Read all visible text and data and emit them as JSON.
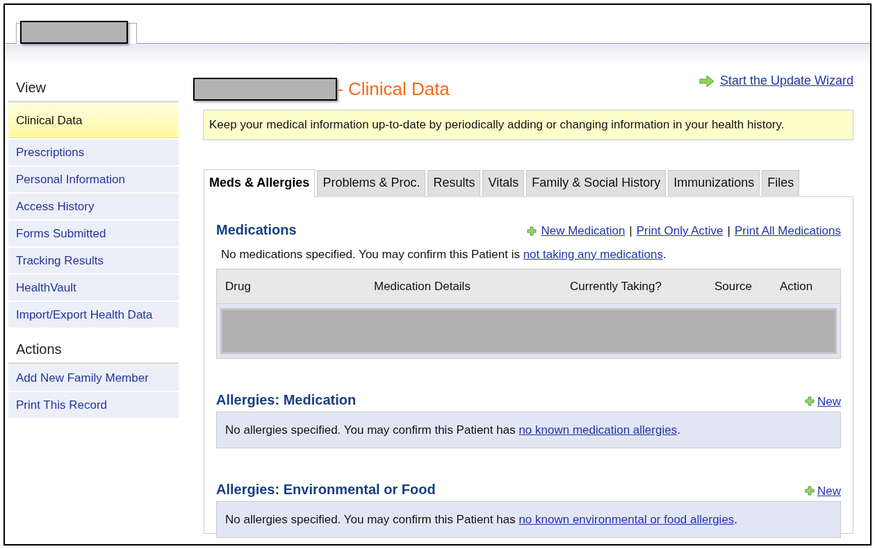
{
  "sidebar": {
    "sections": [
      {
        "title": "View",
        "items": [
          {
            "label": "Clinical Data",
            "selected": true
          },
          {
            "label": "Prescriptions",
            "selected": false
          },
          {
            "label": "Personal Information",
            "selected": false
          },
          {
            "label": "Access History",
            "selected": false
          },
          {
            "label": "Forms Submitted",
            "selected": false
          },
          {
            "label": "Tracking Results",
            "selected": false
          },
          {
            "label": "HealthVault",
            "selected": false
          },
          {
            "label": "Import/Export Health Data",
            "selected": false
          }
        ]
      },
      {
        "title": "Actions",
        "items": [
          {
            "label": "Add New Family Member",
            "selected": false
          },
          {
            "label": "Print This Record",
            "selected": false
          }
        ]
      }
    ]
  },
  "page_title": "- Clinical Data",
  "wizard_link": "Start the Update Wizard",
  "notice": "Keep your medical information up-to-date by periodically adding or changing information in your health history.",
  "tabs": [
    {
      "label": "Meds & Allergies",
      "selected": true
    },
    {
      "label": "Problems & Proc.",
      "selected": false
    },
    {
      "label": "Results",
      "selected": false
    },
    {
      "label": "Vitals",
      "selected": false
    },
    {
      "label": "Family & Social History",
      "selected": false
    },
    {
      "label": "Immunizations",
      "selected": false
    },
    {
      "label": "Files",
      "selected": false
    }
  ],
  "medications": {
    "title": "Medications",
    "links": [
      "New Medication",
      "Print Only Active",
      "Print All Medications"
    ],
    "separator": "|",
    "message": {
      "text": "No medications specified. You may confirm this Patient is ",
      "link": "not taking any medications",
      "end": "."
    },
    "table": {
      "columns": [
        "Drug",
        "Medication Details",
        "Currently Taking?",
        "Source",
        "Action"
      ]
    }
  },
  "allergy_sections": [
    {
      "title": "Allergies: Medication",
      "new_link": "New",
      "message": {
        "text": "No allergies specified. You may confirm this Patient has ",
        "link": "no known medication allergies",
        "end": "."
      }
    },
    {
      "title": "Allergies: Environmental or Food",
      "new_link": "New",
      "message": {
        "text": "No allergies specified. You may confirm this Patient has ",
        "link": "no known environmental or food allergies",
        "end": "."
      }
    }
  ]
}
